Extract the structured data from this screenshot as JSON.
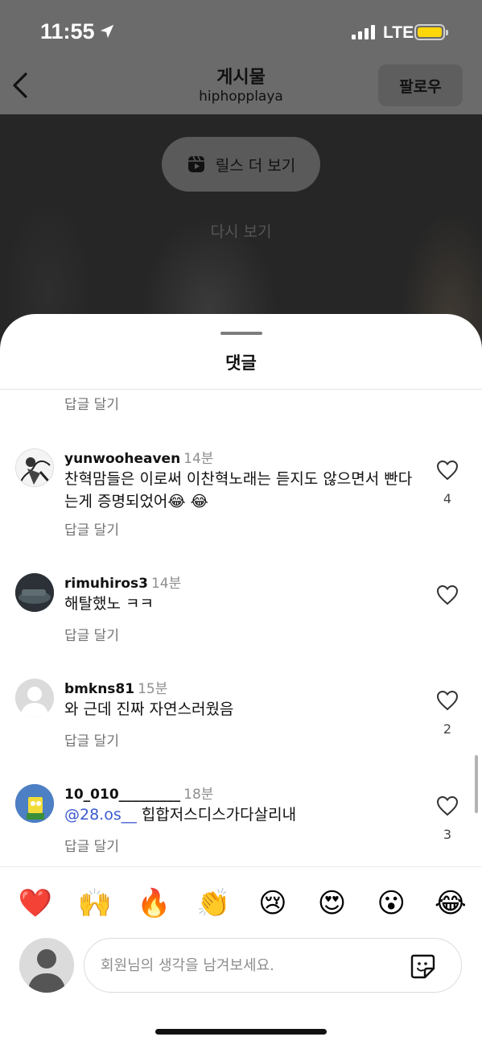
{
  "status_bar": {
    "time": "11:55",
    "network": "LTE"
  },
  "header": {
    "title": "게시물",
    "subtitle": "hiphopplaya",
    "follow_label": "팔로우"
  },
  "reel_overlay": {
    "more_reels_label": "릴스 더 보기",
    "replay_label": "다시 보기"
  },
  "comments_sheet": {
    "title": "댓글",
    "reply_label": "답글 달기",
    "comments": [
      {
        "username": "yunwooheaven",
        "time": "14분",
        "text": "찬혁맘들은 이로써 이찬혁노래는 듣지도 않으면서 빤다는게 증명되었어",
        "emoji": "😂 😂",
        "likes": "4"
      },
      {
        "username": "rimuhiros3",
        "time": "14분",
        "text": "해탈했노 ㅋㅋ",
        "likes": ""
      },
      {
        "username": "bmkns81",
        "time": "15분",
        "text": "와 근데 진짜 자연스러웠음",
        "likes": "2"
      },
      {
        "username": "10_010_________",
        "time": "18분",
        "mention": "@28.os__",
        "text": "힙합저스디스가다살리내",
        "likes": "3"
      }
    ]
  },
  "emoji_bar": [
    "❤️",
    "🙌",
    "🔥",
    "👏",
    "😢",
    "😍",
    "😮",
    "😂"
  ],
  "composer": {
    "placeholder": "회원님의 생각을 남겨보세요."
  },
  "colors": {
    "accent": "#3b5bd0",
    "battery": "#ffd60a"
  }
}
